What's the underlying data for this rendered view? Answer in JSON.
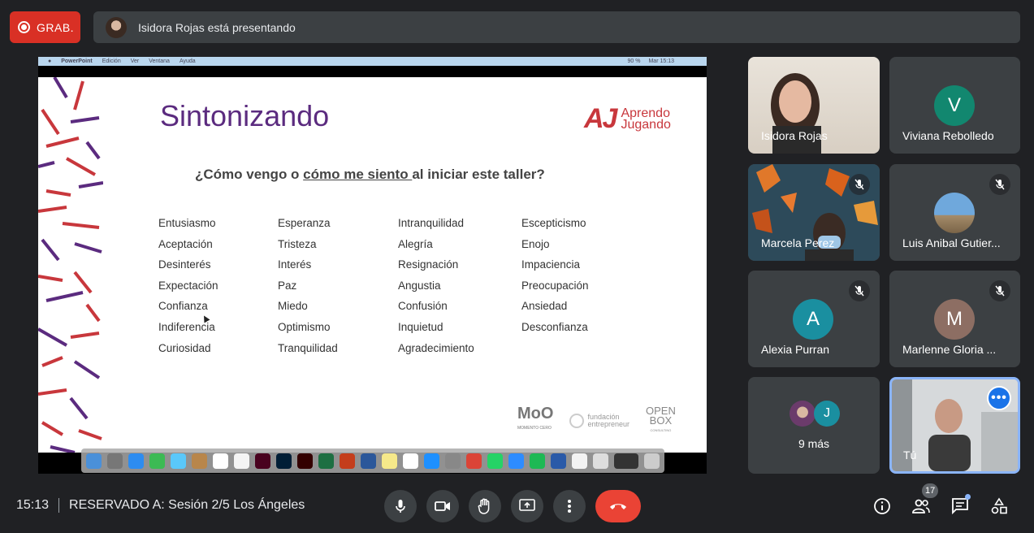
{
  "recording": {
    "label": "GRAB."
  },
  "presenter_bar": {
    "text": "Isidora Rojas está presentando"
  },
  "mac_menubar": {
    "app": "PowerPoint",
    "items": [
      "Edición",
      "Ver",
      "Ventana",
      "Ayuda"
    ],
    "battery": "90 %",
    "clock": "Mar 15:13"
  },
  "slide": {
    "title": "Sintonizando",
    "logo_line1": "Aprendo",
    "logo_line2": "Jugando",
    "question_part1": "¿Cómo vengo o ",
    "question_underlined": "cómo me siento ",
    "question_part2": "al iniciar este taller?",
    "columns": [
      [
        "Entusiasmo",
        "Aceptación",
        "Desinterés",
        "Expectación",
        "Confianza",
        "Indiferencia",
        "Curiosidad"
      ],
      [
        "Esperanza",
        "Tristeza",
        "Interés",
        "Paz",
        "Miedo",
        "Optimismo",
        "Tranquilidad"
      ],
      [
        "Intranquilidad",
        "Alegría",
        "Resignación",
        "Angustia",
        "Confusión",
        "Inquietud",
        "Agradecimiento"
      ],
      [
        "Escepticismo",
        "Enojo",
        "Impaciencia",
        "Preocupación",
        "Ansiedad",
        "Desconfianza"
      ]
    ],
    "sponsors": {
      "moo": "MoO",
      "moo_sub": "MOMENTO CERO",
      "fund_l1": "fundación",
      "fund_l2": "entrepreneur",
      "openbox_l1": "OPEN",
      "openbox_l2": "BOX",
      "openbox_sub": "CONSULTING"
    }
  },
  "participants": [
    {
      "name": "Isidora Rojas",
      "type": "video",
      "muted": false
    },
    {
      "name": "Viviana Rebolledo",
      "initial": "V",
      "color": "#12876f",
      "muted": false
    },
    {
      "name": "Marcela Perez",
      "type": "video",
      "muted": true
    },
    {
      "name": "Luis Anibal Gutier...",
      "type": "photo",
      "muted": true
    },
    {
      "name": "Alexia Purran",
      "initial": "A",
      "color": "#1a8fa0",
      "muted": true
    },
    {
      "name": "Marlenne Gloria ...",
      "initial": "M",
      "color": "#8d6e63",
      "muted": true
    },
    {
      "name": "9 más",
      "extra_initial": "J",
      "extra_color": "#1a8fa0"
    },
    {
      "name": "Tú",
      "type": "self"
    }
  ],
  "meeting": {
    "time": "15:13",
    "title": "RESERVADO A: Sesión 2/5 Los Ángeles",
    "participant_count": "17"
  },
  "colors": {
    "end_call": "#ea4335",
    "record": "#d93025",
    "accent": "#8ab4f8"
  }
}
